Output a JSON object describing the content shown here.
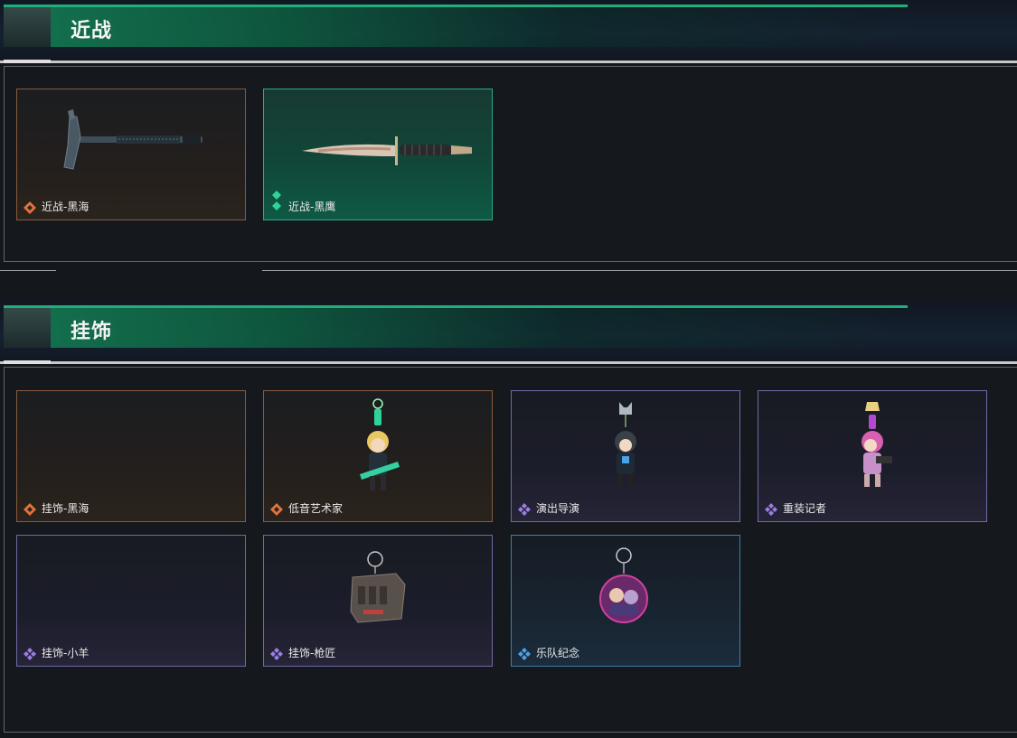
{
  "sections": [
    {
      "title": "近战",
      "items": [
        {
          "label": "近战-黑海",
          "rarity_color": "#e0743a",
          "rarity_icon": "orange-diamond-icon",
          "art": "hatchet-icon"
        },
        {
          "label": "近战-黑鹰",
          "rarity_color": "#2fd39a",
          "rarity_icon": "green-diamond-icon",
          "art": "knife-icon"
        }
      ]
    },
    {
      "title": "挂饰",
      "items": [
        {
          "label": "挂饰-黑海",
          "rarity_color": "#e0743a",
          "rarity_icon": "orange-diamond-icon",
          "art": ""
        },
        {
          "label": "低音艺术家",
          "rarity_color": "#e0743a",
          "rarity_icon": "orange-diamond-icon",
          "art": "bassist-charm-icon"
        },
        {
          "label": "演出导演",
          "rarity_color": "#9b7de6",
          "rarity_icon": "purple-diamond-icon",
          "art": "director-charm-icon"
        },
        {
          "label": "重装记者",
          "rarity_color": "#9b7de6",
          "rarity_icon": "purple-diamond-icon",
          "art": "reporter-charm-icon"
        },
        {
          "label": "挂饰-小羊",
          "rarity_color": "#9b7de6",
          "rarity_icon": "purple-diamond-icon",
          "art": ""
        },
        {
          "label": "挂饰-枪匠",
          "rarity_color": "#9b7de6",
          "rarity_icon": "purple-diamond-icon",
          "art": "gunsmith-charm-icon"
        },
        {
          "label": "乐队纪念",
          "rarity_color": "#4aa3e8",
          "rarity_icon": "blue-diamond-icon",
          "art": "band-badge-icon"
        }
      ]
    }
  ]
}
